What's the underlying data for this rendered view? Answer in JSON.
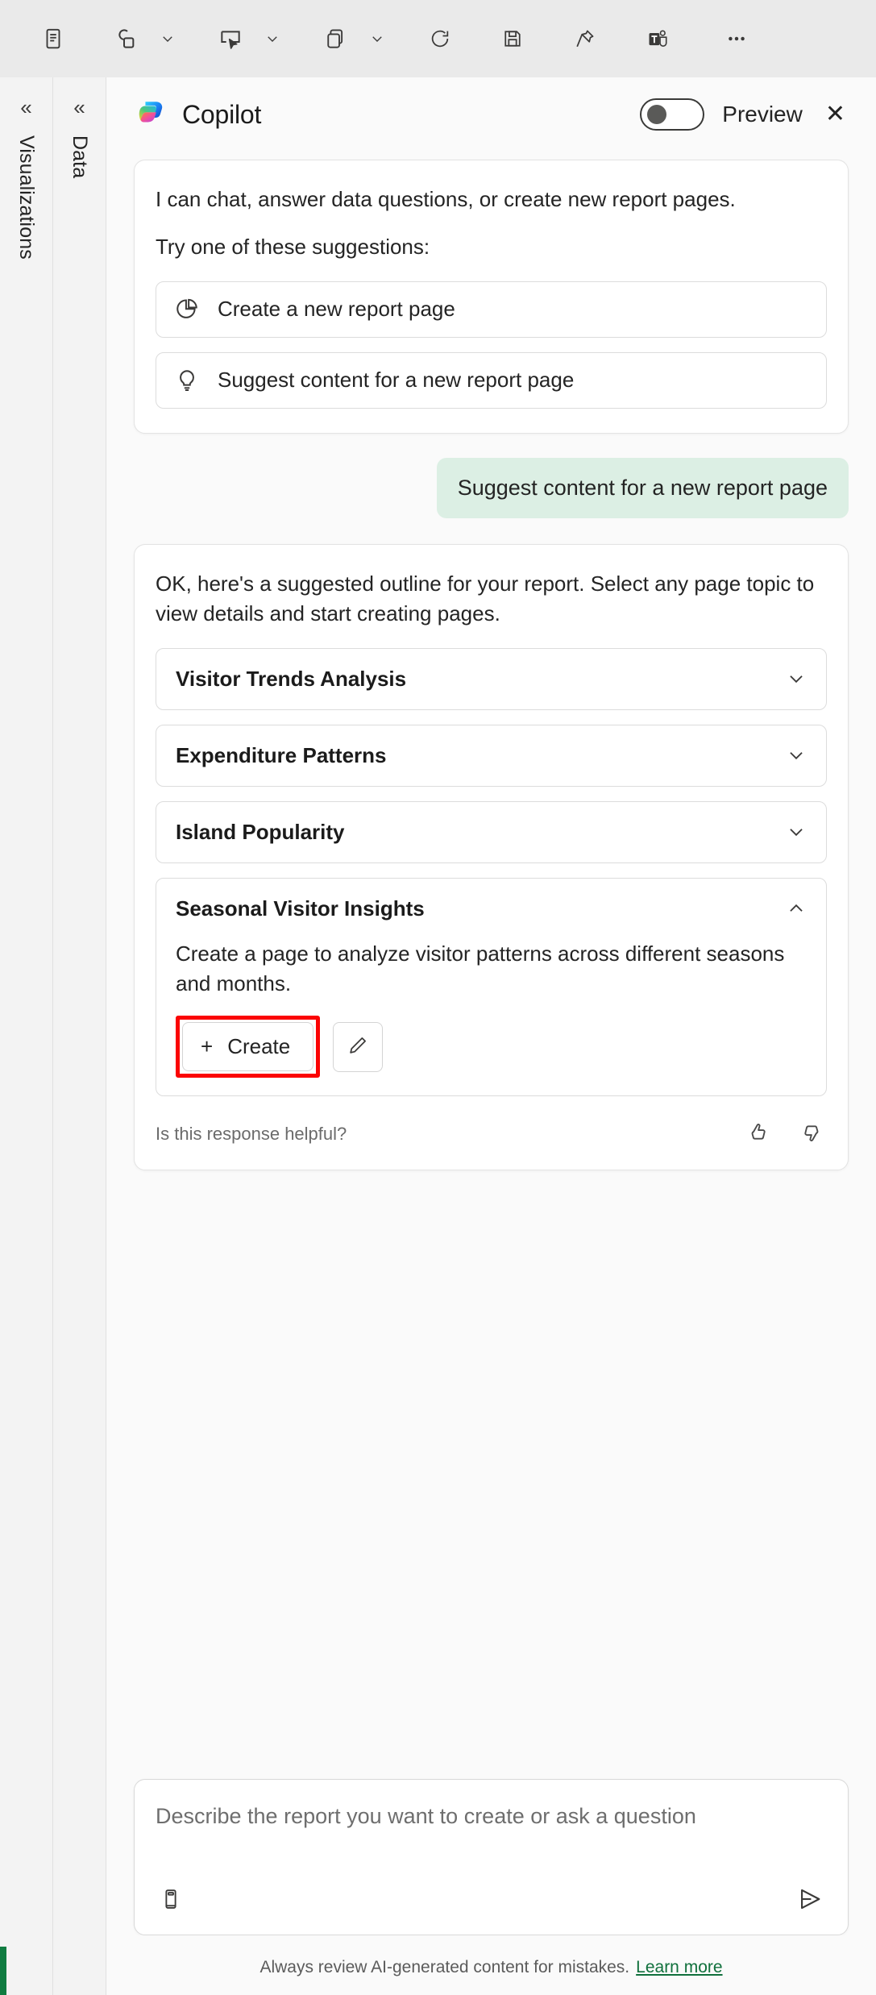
{
  "toolbar": {
    "items": [
      {
        "name": "text-box-icon",
        "label": "Text box"
      },
      {
        "name": "shapes-icon",
        "label": "Shapes"
      },
      {
        "name": "shapes-caret-icon",
        "label": "Shapes options"
      },
      {
        "name": "buttons-icon",
        "label": "Buttons"
      },
      {
        "name": "buttons-caret-icon",
        "label": "Buttons options"
      },
      {
        "name": "visual-icon",
        "label": "New visual"
      },
      {
        "name": "visual-caret-icon",
        "label": "Visual options"
      },
      {
        "name": "refresh-icon",
        "label": "Refresh"
      },
      {
        "name": "save-icon",
        "label": "Save"
      },
      {
        "name": "pin-icon",
        "label": "Pin to dashboard"
      },
      {
        "name": "teams-icon",
        "label": "Chat in Teams"
      },
      {
        "name": "more-options-icon",
        "label": "More options"
      }
    ]
  },
  "rails": [
    {
      "label": "Visualizations",
      "chevron": "«",
      "name": "sidebar-rail-visualizations"
    },
    {
      "label": "Data",
      "chevron": "«",
      "name": "sidebar-rail-data"
    }
  ],
  "copilot": {
    "title": "Copilot",
    "logo_icon": "copilot-logo-icon",
    "preview_label": "Preview",
    "toggle_state": "off",
    "close_label": "✕"
  },
  "intro": {
    "line1": "I can chat, answer data questions, or create new report pages.",
    "line2": "Try one of these suggestions:",
    "suggestions": [
      {
        "label": "Create a new report page",
        "icon": "pie-chart-icon"
      },
      {
        "label": "Suggest content for a new report page",
        "icon": "lightbulb-icon"
      }
    ]
  },
  "user_message": {
    "text": "Suggest content for a new report page"
  },
  "response": {
    "intro": "OK, here's a suggested outline for your report. Select any page topic to view details and start creating pages.",
    "items": [
      {
        "title": "Visitor Trends Analysis",
        "expanded": false,
        "chevron": "chevron-down-icon"
      },
      {
        "title": "Expenditure Patterns",
        "expanded": false,
        "chevron": "chevron-down-icon"
      },
      {
        "title": "Island Popularity",
        "expanded": false,
        "chevron": "chevron-down-icon"
      },
      {
        "title": "Seasonal Visitor Insights",
        "expanded": true,
        "chevron": "chevron-up-icon",
        "description": "Create a page to analyze visitor patterns across different seasons and months.",
        "create_label": "Create",
        "create_plus": "+",
        "edit_icon": "pencil-icon"
      }
    ],
    "feedback_text": "Is this response helpful?",
    "thumbs_up_icon": "thumbs-up-icon",
    "thumbs_down_icon": "thumbs-down-icon"
  },
  "composer": {
    "placeholder": "Describe the report you want to create or ask a question",
    "value": "",
    "prompt_guide_icon": "book-icon",
    "send_icon": "send-icon"
  },
  "footer": {
    "text": "Always review AI-generated content for mistakes.",
    "link": "Learn more"
  },
  "colors": {
    "toolbar_bg": "#eaeaea",
    "rail_bg": "#f3f3f3",
    "panel_bg": "#fafafa",
    "user_bubble_bg": "#dcefe4",
    "highlight_red": "#fb0404",
    "link_green": "#10703c",
    "accent_green": "#107c41"
  }
}
